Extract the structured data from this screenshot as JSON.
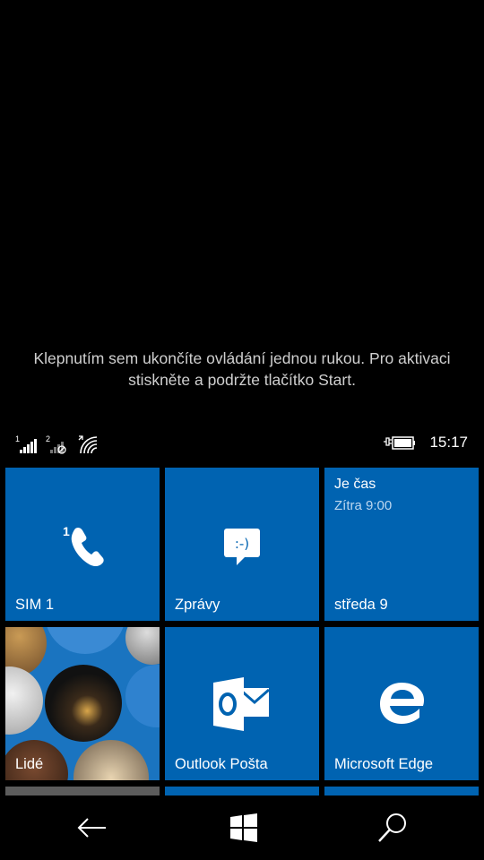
{
  "hint": {
    "line1": "Klepnutím sem ukončíte ovládání jednou rukou. Pro aktivaci",
    "line2": "stiskněte a podržte tlačítko Start."
  },
  "status": {
    "sim1_badge": "1",
    "sim2_badge": "2",
    "time": "15:17"
  },
  "tiles": {
    "phone": {
      "label": "SIM 1",
      "badge": "1",
      "icon": "phone-icon"
    },
    "messages": {
      "label": "Zprávy",
      "icon": "messaging-icon",
      "glyph": ":-)"
    },
    "calendar": {
      "title": "Je čas",
      "subtitle": "Zítra 9:00",
      "label": "středa 9"
    },
    "people": {
      "label": "Lidé"
    },
    "outlook": {
      "label": "Outlook Pošta",
      "icon": "outlook-mail-icon"
    },
    "edge": {
      "label": "Microsoft Edge",
      "icon": "edge-icon"
    }
  },
  "colors": {
    "tile": "#0063b1",
    "background": "#000000"
  },
  "nav": {
    "back_icon": "back-arrow-icon",
    "start_icon": "windows-start-icon",
    "search_icon": "search-icon"
  }
}
